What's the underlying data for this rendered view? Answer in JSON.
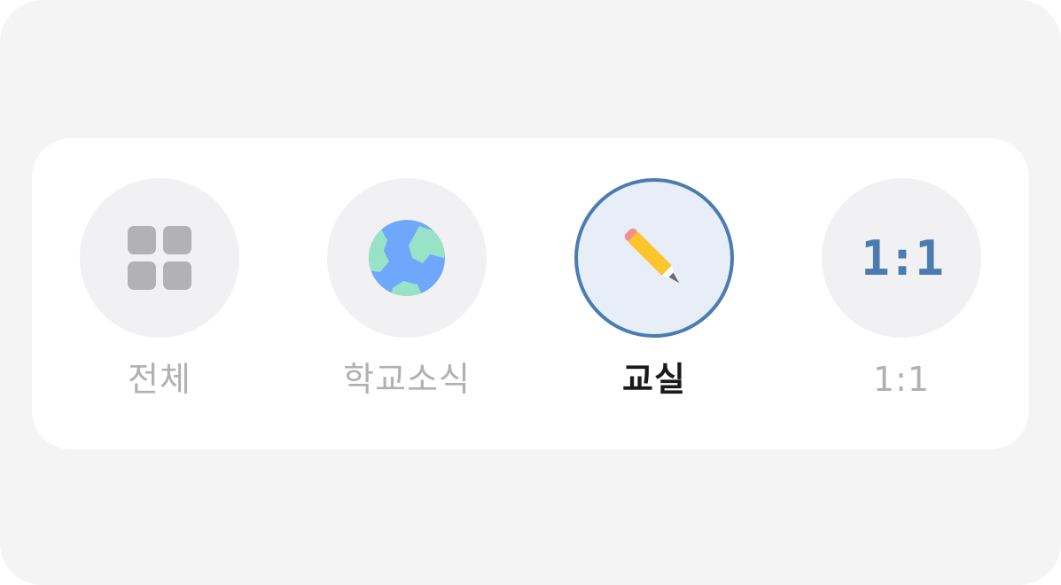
{
  "categories": [
    {
      "label": "전체",
      "icon": "grid-icon",
      "active": false
    },
    {
      "label": "학교소식",
      "icon": "globe-icon",
      "active": false
    },
    {
      "label": "교실",
      "icon": "pencil-icon",
      "active": true
    },
    {
      "label": "1:1",
      "icon": "one-to-one-icon",
      "icon_text": "1:1",
      "active": false
    }
  ],
  "colors": {
    "active_border": "#4a7bb1",
    "active_fill": "#e8eef8",
    "inactive_fill": "#f1f1f3",
    "inactive_label": "#b0b0b5",
    "active_label": "#1a1a1a"
  }
}
